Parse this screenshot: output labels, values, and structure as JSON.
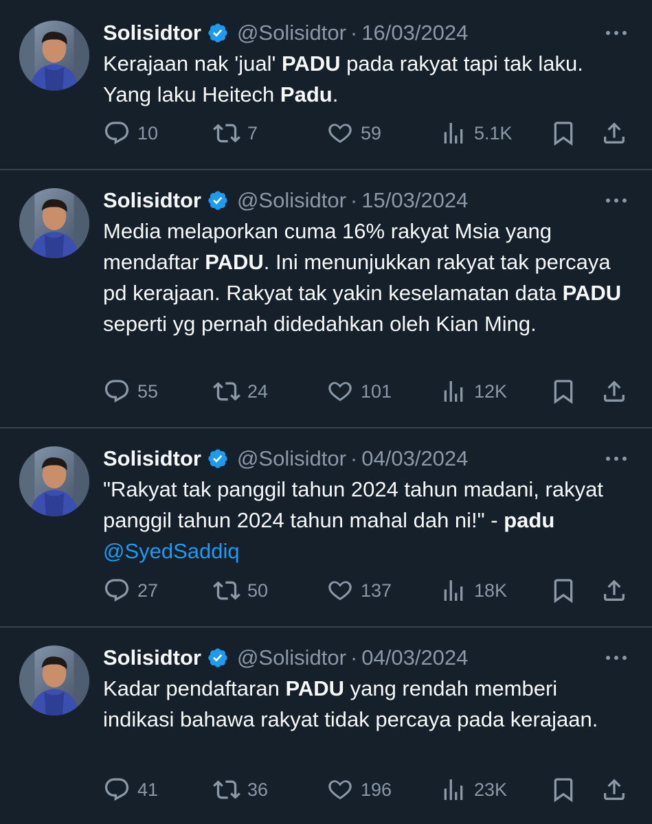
{
  "tweets": [
    {
      "name": "Solisidtor",
      "handle": "@Solisidtor",
      "separator": "·",
      "date": "16/03/2024",
      "text_parts": [
        {
          "t": "Kerajaan nak 'jual' ",
          "b": false
        },
        {
          "t": "PADU",
          "b": true
        },
        {
          "t": " pada rakyat tapi tak laku. Yang laku Heitech ",
          "b": false
        },
        {
          "t": "Padu",
          "b": true
        },
        {
          "t": ".",
          "b": false
        }
      ],
      "replies": "10",
      "retweets": "7",
      "likes": "59",
      "views": "5.1K"
    },
    {
      "name": "Solisidtor",
      "handle": "@Solisidtor",
      "separator": "·",
      "date": "15/03/2024",
      "text_parts": [
        {
          "t": "Media melaporkan cuma 16% rakyat Msia yang mendaftar ",
          "b": false
        },
        {
          "t": "PADU",
          "b": true
        },
        {
          "t": ". Ini menunjukkan rakyat tak percaya pd kerajaan. Rakyat tak yakin keselamatan data ",
          "b": false
        },
        {
          "t": "PADU",
          "b": true
        },
        {
          "t": " seperti yg pernah didedahkan oleh Kian Ming.",
          "b": false
        }
      ],
      "replies": "55",
      "retweets": "24",
      "likes": "101",
      "views": "12K"
    },
    {
      "name": "Solisidtor",
      "handle": "@Solisidtor",
      "separator": "·",
      "date": "04/03/2024",
      "text_parts": [
        {
          "t": "\"Rakyat tak panggil tahun 2024 tahun madani, rakyat panggil tahun 2024 tahun mahal dah ni!\" - ",
          "b": false
        },
        {
          "t": "padu",
          "b": true
        },
        {
          "t": " ",
          "b": false
        },
        {
          "t": "@SyedSaddiq",
          "b": false,
          "m": true
        }
      ],
      "replies": "27",
      "retweets": "50",
      "likes": "137",
      "views": "18K"
    },
    {
      "name": "Solisidtor",
      "handle": "@Solisidtor",
      "separator": "·",
      "date": "04/03/2024",
      "text_parts": [
        {
          "t": "Kadar pendaftaran ",
          "b": false
        },
        {
          "t": "PADU",
          "b": true
        },
        {
          "t": " yang rendah memberi indikasi bahawa rakyat tidak percaya pada kerajaan.",
          "b": false
        }
      ],
      "replies": "41",
      "retweets": "36",
      "likes": "196",
      "views": "23K"
    }
  ],
  "colors": {
    "background": "#15202b",
    "text": "#f7f9f9",
    "muted": "#8b98a5",
    "accent": "#1d9bf0",
    "divider": "#38444d"
  },
  "icons": [
    "verified-badge-icon",
    "more-icon",
    "reply-icon",
    "retweet-icon",
    "like-icon",
    "views-icon",
    "bookmark-icon",
    "share-icon"
  ]
}
